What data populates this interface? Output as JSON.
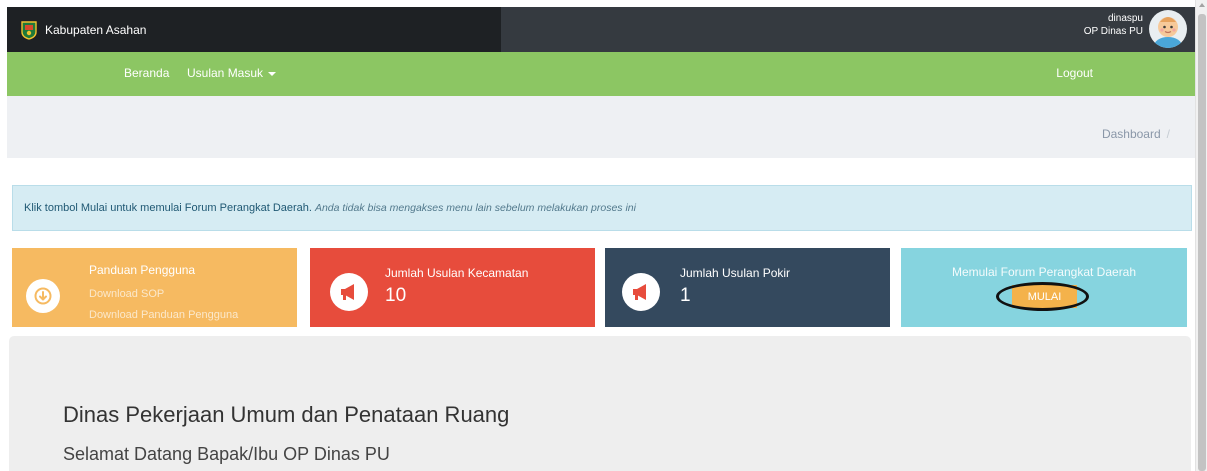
{
  "brand": {
    "name": "Kabupaten Asahan",
    "logo_icon": "asahan-logo-icon"
  },
  "user": {
    "username": "dinaspu",
    "role": "OP Dinas PU",
    "avatar_icon": "baby-avatar-icon"
  },
  "nav": {
    "home": "Beranda",
    "usulan": "Usulan Masuk",
    "logout": "Logout"
  },
  "breadcrumb": {
    "current": "Dashboard",
    "separator": "/"
  },
  "alert": {
    "strong": "Klik tombol Mulai untuk memulai Forum Perangkat Daerah.",
    "note": "Anda tidak bisa mengakses menu lain sebelum melakukan proses ini"
  },
  "cards": {
    "panduan": {
      "title": "Panduan Pengguna",
      "link_sop": "Download SOP",
      "link_panduan": "Download Panduan Pengguna",
      "icon": "download-circle-icon"
    },
    "kecamatan": {
      "title": "Jumlah Usulan Kecamatan",
      "value": "10",
      "icon": "megaphone-icon"
    },
    "pokir": {
      "title": "Jumlah Usulan Pokir",
      "value": "1",
      "icon": "megaphone-icon"
    },
    "forum": {
      "title": "Memulai Forum Perangkat Daerah",
      "button": "MULAI"
    }
  },
  "jumbotron": {
    "title": "Dinas Pekerjaan Umum dan Penataan Ruang",
    "subtitle": "Selamat Datang Bapak/Ibu OP Dinas PU"
  },
  "colors": {
    "panduan": "#f6ba61",
    "kecamatan": "#e74c3c",
    "pokir": "#34495e",
    "forum": "#86d4df",
    "navbar": "#8cc663",
    "button": "#f4b24b"
  }
}
